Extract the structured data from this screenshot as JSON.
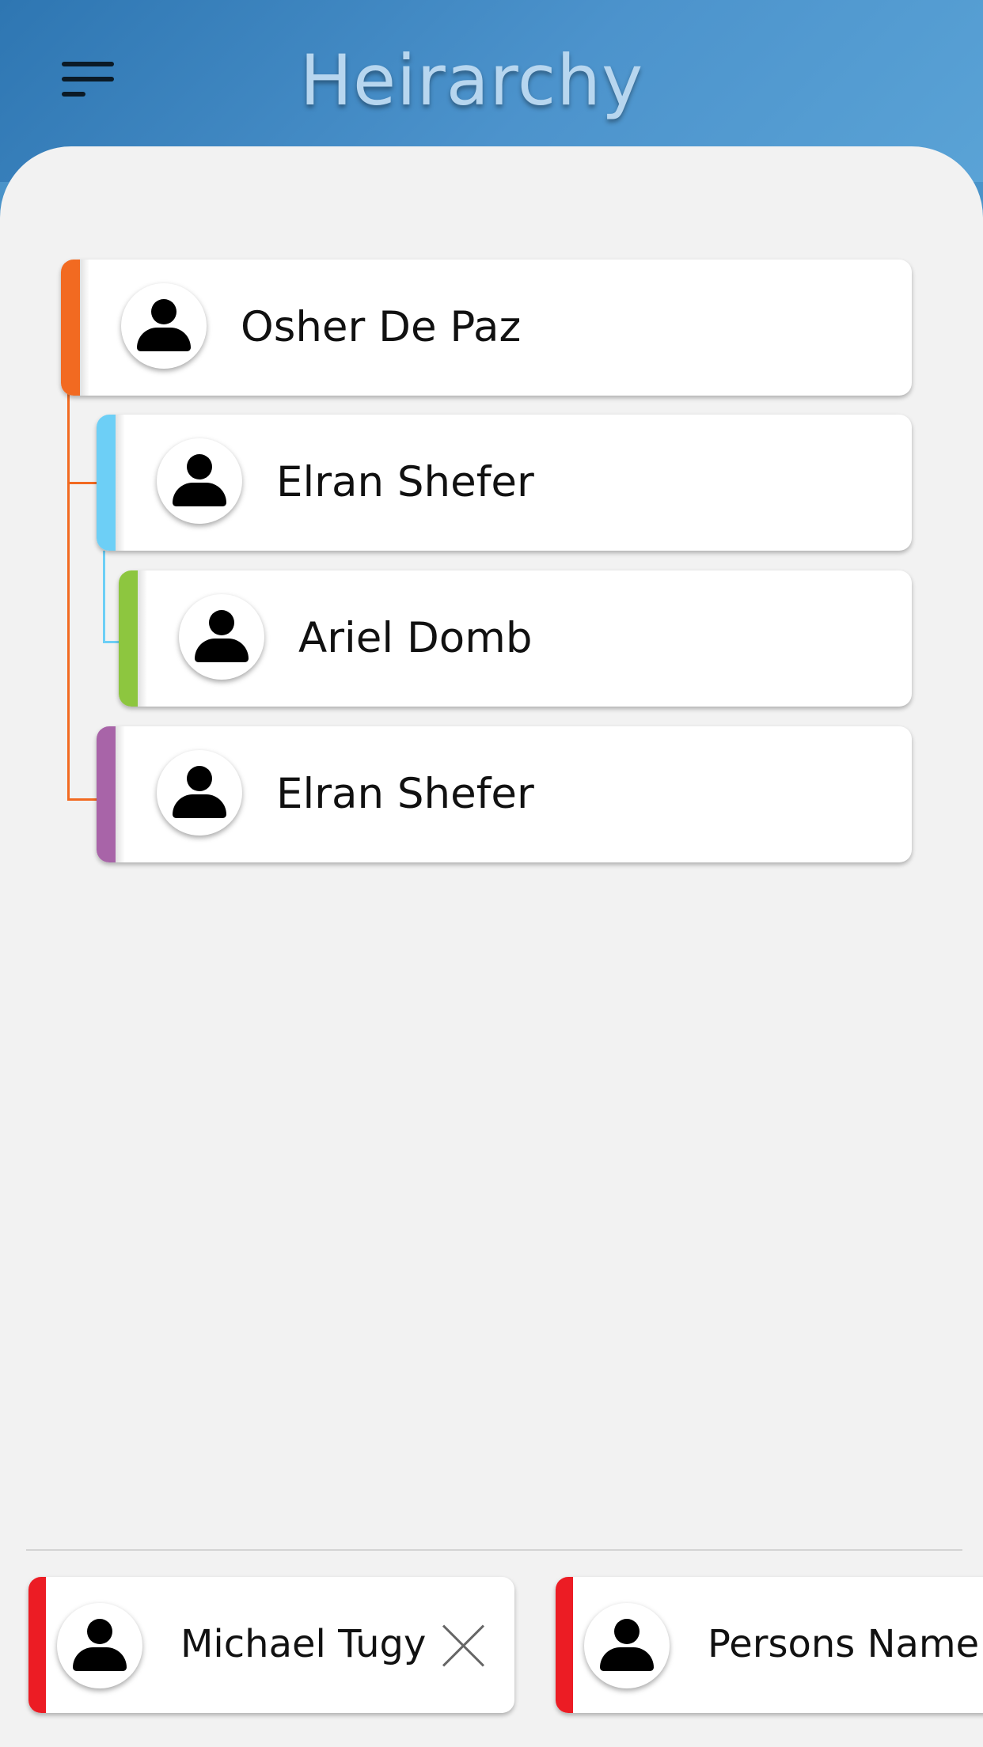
{
  "header": {
    "title": "Heirarchy"
  },
  "hierarchy": [
    {
      "name": "Osher De Paz",
      "color": "#f26a21"
    },
    {
      "name": "Elran Shefer",
      "color": "#6dcff6"
    },
    {
      "name": "Ariel Domb",
      "color": "#8dc63f"
    },
    {
      "name": "Elran Shefer",
      "color": "#a864a8"
    }
  ],
  "selected": [
    {
      "name": "Michael Tugy",
      "color": "#ec1c24"
    },
    {
      "name": "Persons Name",
      "color": "#ec1c24"
    }
  ],
  "icons": {
    "menu": "menu-icon",
    "person": "person-icon",
    "close": "close-icon"
  }
}
